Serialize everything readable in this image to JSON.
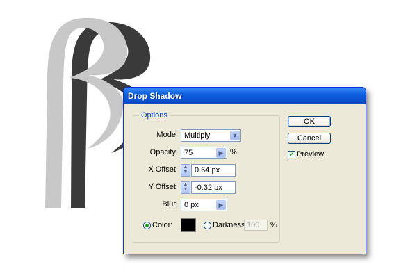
{
  "colors": {
    "artwork_fill": "#c8c8c8",
    "artwork_shadow": "#3a3a3a",
    "title_bar": "#0a4fcf",
    "dialog_face": "#ece9d8",
    "shadow_color": "#000000"
  },
  "dialog": {
    "title": "Drop Shadow",
    "options": {
      "legend": "Options",
      "mode": {
        "label": "Mode:",
        "value": "Multiply",
        "icon": "chevron-down-icon"
      },
      "opacity": {
        "label": "Opacity:",
        "value": "75",
        "unit": "%",
        "icon": "chevron-right-icon"
      },
      "x_offset": {
        "label": "X Offset:",
        "value": "0.64 px",
        "icon": "spinner-icon"
      },
      "y_offset": {
        "label": "Y Offset:",
        "value": "-0.32 px",
        "icon": "spinner-icon"
      },
      "blur": {
        "label": "Blur:",
        "value": "0 px",
        "icon": "chevron-right-icon"
      },
      "color": {
        "label": "Color:",
        "selected": true
      },
      "darkness": {
        "label": "Darkness:",
        "value": "100",
        "unit": "%",
        "selected": false,
        "enabled": false
      }
    },
    "buttons": {
      "ok": "OK",
      "cancel": "Cancel"
    },
    "preview": {
      "label": "Preview",
      "checked": true
    }
  }
}
